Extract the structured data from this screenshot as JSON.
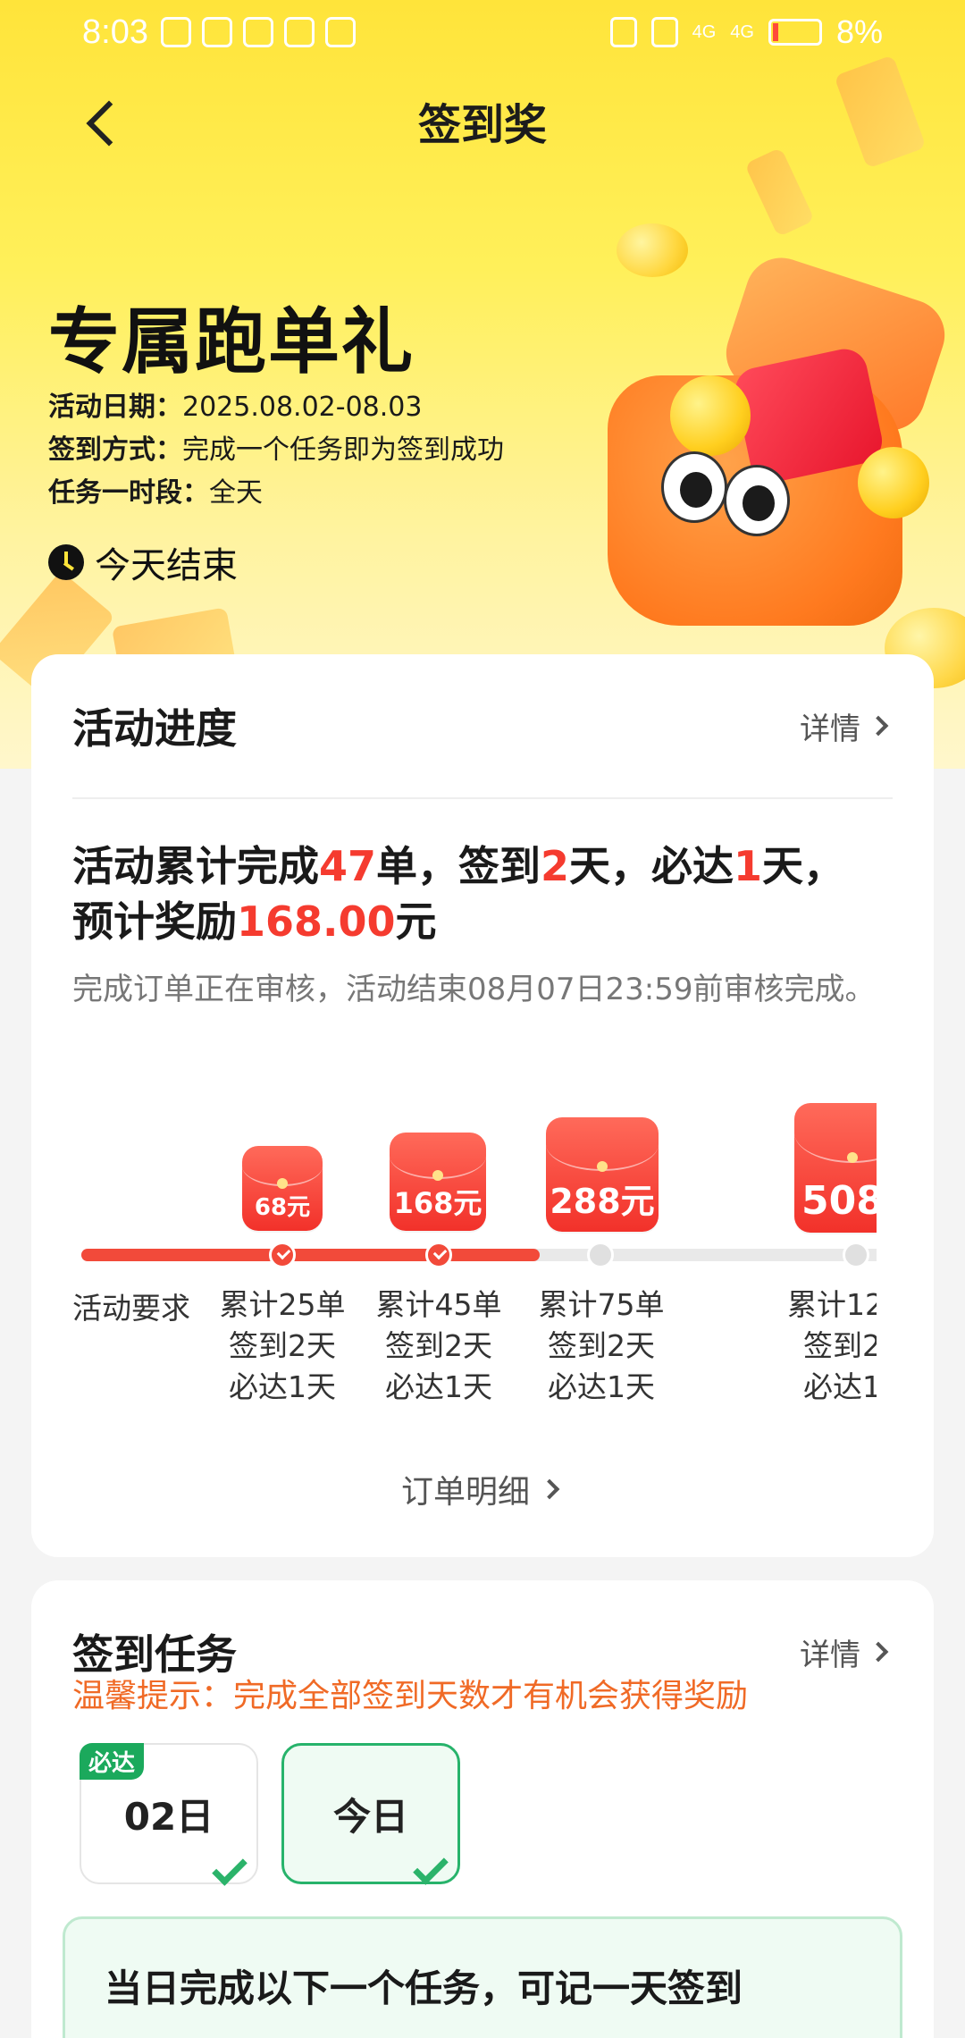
{
  "status_bar": {
    "time": "8:03",
    "battery": "8%",
    "network_1": "4G",
    "network_2": "4G"
  },
  "header": {
    "title": "签到奖"
  },
  "promo": {
    "title": "专属跑单礼",
    "info": [
      {
        "label": "活动日期：",
        "value": "2025.08.02-08.03"
      },
      {
        "label": "签到方式：",
        "value": "完成一个任务即为签到成功"
      },
      {
        "label": "任务一时段：",
        "value": "全天"
      }
    ],
    "end_text": "今天结束"
  },
  "progress_card": {
    "title": "活动进度",
    "detail_label": "详情",
    "summary": {
      "p1": "活动累计完成",
      "orders": "47",
      "p2": "单，签到",
      "signin_days": "2",
      "p3": "天，必达",
      "must_days": "1",
      "p4": "天，",
      "p5": "预计奖励",
      "reward": "168.00",
      "p6": "元"
    },
    "note": "完成订单正在审核，活动结束08月07日23:59前审核完成。",
    "requirement_label": "活动要求",
    "progress_fraction": 0.57,
    "tiers": [
      {
        "reward": "68元",
        "line1": "累计25单",
        "line2": "签到2天",
        "line3": "必达1天",
        "done": true
      },
      {
        "reward": "168元",
        "line1": "累计45单",
        "line2": "签到2天",
        "line3": "必达1天",
        "done": true
      },
      {
        "reward": "288元",
        "line1": "累计75单",
        "line2": "签到2天",
        "line3": "必达1天",
        "done": false
      },
      {
        "reward": "508",
        "line1": "累计12",
        "line2": "签到2",
        "line3": "必达1",
        "done": false
      }
    ],
    "order_detail_label": "订单明细"
  },
  "signin_card": {
    "title": "签到任务",
    "detail_label": "详情",
    "tip": "温馨提示：完成全部签到天数才有机会获得奖励",
    "days": [
      {
        "label": "02日",
        "badge": "必达",
        "checked": true
      },
      {
        "label": "今日",
        "badge": "",
        "checked": true
      }
    ],
    "task_text": "当日完成以下一个任务，可记一天签到"
  },
  "colors": {
    "accent_red": "#f53b2f",
    "accent_green": "#1ba95c",
    "hero_yellow": "#ffe43a"
  },
  "icons": [
    "back-arrow-icon",
    "clock-icon",
    "chevron-right-icon",
    "check-icon"
  ]
}
